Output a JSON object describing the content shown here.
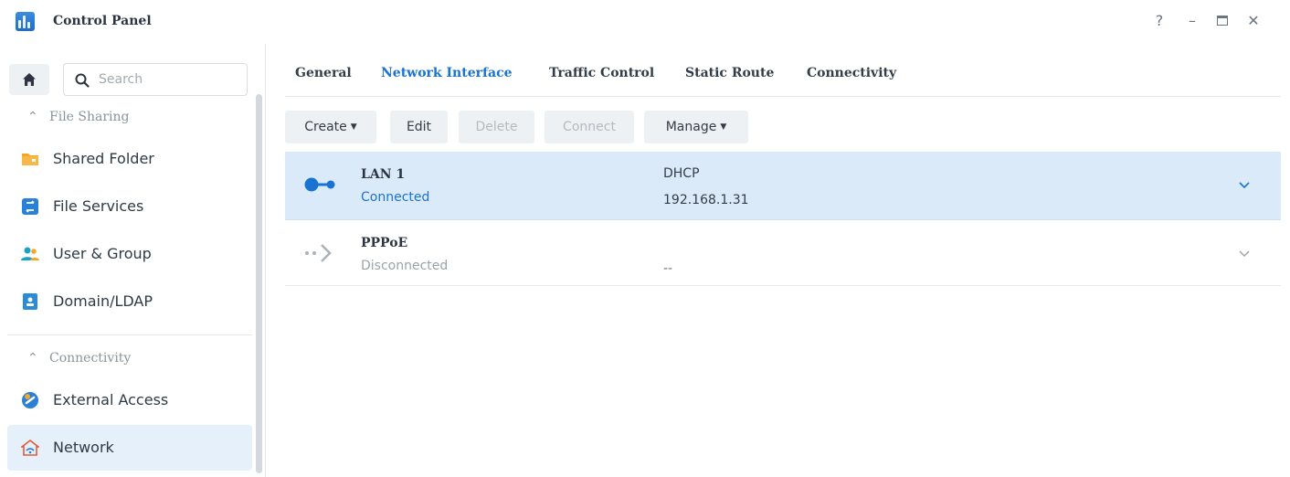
{
  "window": {
    "title": "Control Panel",
    "controls": {
      "help": "?",
      "minimize": "–",
      "maximize": "□",
      "close": "✕"
    }
  },
  "sidebar": {
    "search_placeholder": "Search",
    "sections": [
      {
        "label": "File Sharing",
        "items": [
          {
            "label": "Shared Folder",
            "icon": "folder-icon",
            "color": "#f5a623"
          },
          {
            "label": "File Services",
            "icon": "file-services-icon",
            "color": "#2a7fd6"
          },
          {
            "label": "User & Group",
            "icon": "users-icon",
            "color": "#17a2c9"
          },
          {
            "label": "Domain/LDAP",
            "icon": "domain-icon",
            "color": "#2a8bd6"
          }
        ]
      },
      {
        "label": "Connectivity",
        "items": [
          {
            "label": "External Access",
            "icon": "external-access-icon",
            "color": "#2a7fd6"
          },
          {
            "label": "Network",
            "icon": "network-home-icon",
            "color": "#e05a3c",
            "active": true
          }
        ]
      }
    ]
  },
  "tabs": [
    {
      "label": "General"
    },
    {
      "label": "Network Interface",
      "active": true
    },
    {
      "label": "Traffic Control"
    },
    {
      "label": "Static Route"
    },
    {
      "label": "Connectivity"
    }
  ],
  "toolbar": {
    "create": "Create",
    "edit": "Edit",
    "delete": "Delete",
    "connect": "Connect",
    "manage": "Manage"
  },
  "interfaces": [
    {
      "name": "LAN 1",
      "status": "Connected",
      "mode": "DHCP",
      "ip": "192.168.1.31",
      "selected": true,
      "status_color": "#1a73d1"
    },
    {
      "name": "PPPoE",
      "status": "Disconnected",
      "mode": "",
      "ip": "--",
      "selected": false,
      "status_color": "#9aa3ab"
    }
  ],
  "colors": {
    "accent": "#1a73d1",
    "selected_row": "#dbeaf9",
    "active_nav": "#e6f0fa"
  }
}
